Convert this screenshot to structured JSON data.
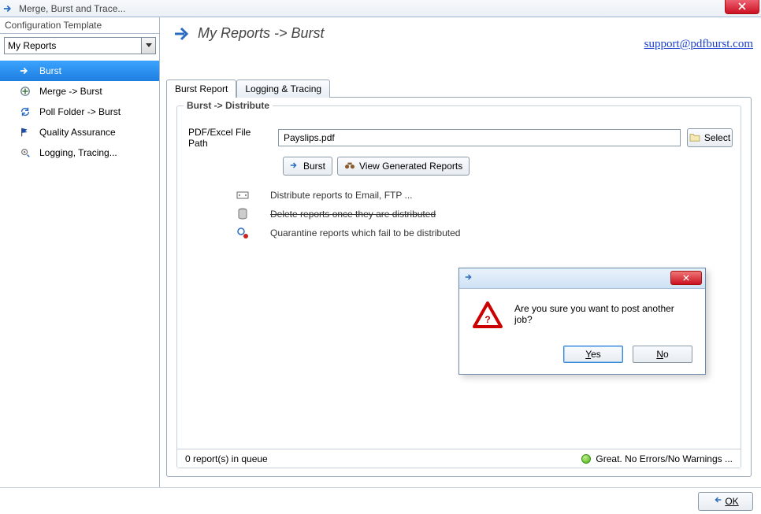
{
  "window": {
    "title": "Merge, Burst and Trace..."
  },
  "sidebar": {
    "header": "Configuration Template",
    "selected_template": "My Reports",
    "items": [
      {
        "label": "Burst",
        "icon": "arrow-right"
      },
      {
        "label": "Merge -> Burst",
        "icon": "plus"
      },
      {
        "label": "Poll Folder -> Burst",
        "icon": "refresh"
      },
      {
        "label": "Quality Assurance",
        "icon": "flag"
      },
      {
        "label": "Logging, Tracing...",
        "icon": "gear"
      }
    ]
  },
  "header": {
    "breadcrumb": "My Reports -> Burst",
    "support_link": "support@pdfburst.com"
  },
  "tabs": {
    "items": [
      {
        "label": "Burst Report"
      },
      {
        "label": "Logging & Tracing"
      }
    ]
  },
  "group": {
    "legend": "Burst -> Distribute"
  },
  "form": {
    "filepath_label": "PDF/Excel File Path",
    "filepath_value": "Payslips.pdf",
    "select_label": "Select",
    "burst_button": "Burst",
    "view_button": "View Generated Reports",
    "opts": [
      {
        "label": "Distribute reports to Email, FTP ...",
        "strike": false
      },
      {
        "label": "Delete reports once they are distributed",
        "strike": true
      },
      {
        "label": "Quarantine reports which fail to be distributed",
        "strike": false
      }
    ]
  },
  "status": {
    "queue": "0 report(s) in queue",
    "right": "Great. No Errors/No Warnings ..."
  },
  "bottom": {
    "ok": "OK"
  },
  "modal": {
    "message": "Are you sure you want to post another job?",
    "yes": "Yes",
    "no": "No"
  }
}
